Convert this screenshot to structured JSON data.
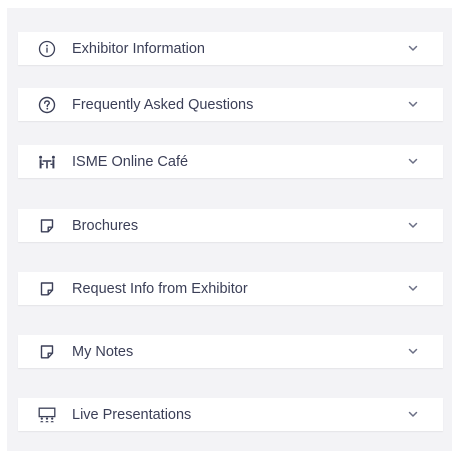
{
  "accordion": {
    "items": [
      {
        "label": "Exhibitor Information",
        "icon": "info-circle-icon"
      },
      {
        "label": "Frequently Asked Questions",
        "icon": "question-circle-icon"
      },
      {
        "label": "ISME Online Café",
        "icon": "people-table-icon"
      },
      {
        "label": "Brochures",
        "icon": "note-icon"
      },
      {
        "label": "Request Info from Exhibitor",
        "icon": "note-icon"
      },
      {
        "label": "My Notes",
        "icon": "note-icon"
      },
      {
        "label": "Live Presentations",
        "icon": "presentation-audience-icon"
      }
    ]
  },
  "colors": {
    "panel_background": "#f3f3f6",
    "item_background": "#ffffff",
    "text": "#3b3f57",
    "icon": "#3b3f57",
    "chevron": "#6b6f85"
  }
}
